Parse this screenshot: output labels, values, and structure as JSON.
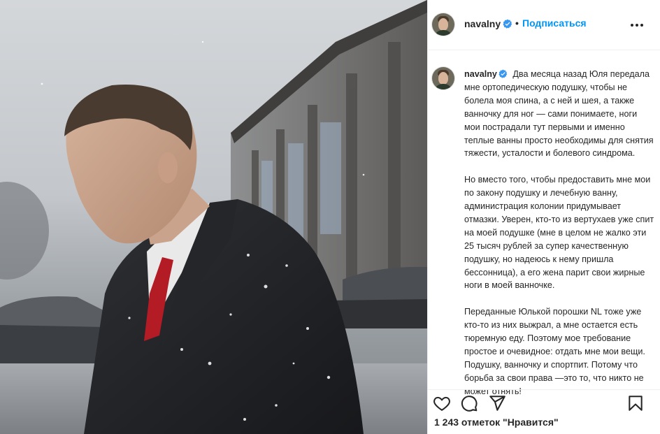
{
  "post": {
    "username": "navalny",
    "follow_label": "Подписаться",
    "separator": "•",
    "caption_user": "navalny",
    "caption_paragraphs": [
      "Два месяца назад Юля передала мне ортопедическую подушку, чтобы не болела моя спина, а с ней и шея, а также ванночку для ног — сами понимаете, ноги мои пострадали тут первыми и именно теплые ванны просто необходимы для снятия тяжести, усталости и болевого синдрома.",
      "Но вместо того, чтобы предоставить мне мои по закону подушку и лечебную ванну, администрация колонии придумывает отмазки.  Уверен, кто-то из вертухаев уже спит на моей подушке (мне в целом не жалко эти 25 тысяч рублей за супер качественную подушку, но надеюсь к нему пришла бессонница), а его жена парит свои жирные ноги в моей ванночке.",
      "Переданные Юлькой порошки NL тоже уже кто-то из них выжрал, а мне остается есть тюремную еду. Поэтому мое требование простое и очевидное: отдать мне мои вещи. Подушку, ванночку и спортпит. Потому что борьба за свои права —это  то, что никто не может отнять!"
    ],
    "likes_text": "1 243  отметок \"Нравится\""
  },
  "icons": {
    "verified": "verified-badge-icon",
    "more": "more-options-icon",
    "like": "heart-icon",
    "comment": "comment-icon",
    "share": "share-icon",
    "save": "bookmark-icon"
  },
  "colors": {
    "accent": "#0095f6",
    "text": "#262626",
    "divider": "#efefef"
  }
}
